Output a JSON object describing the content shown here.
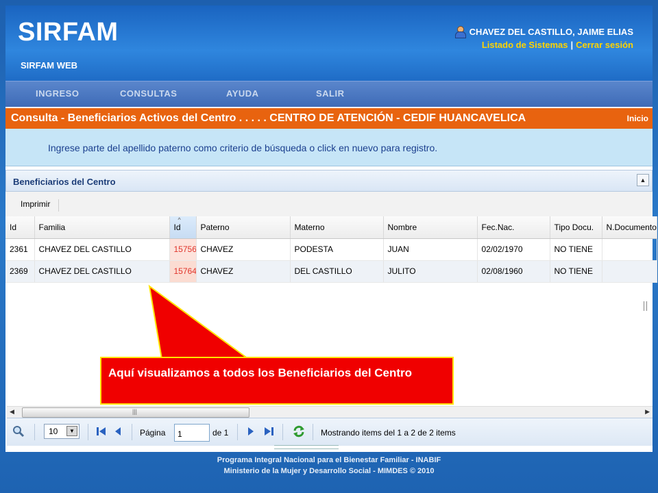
{
  "header": {
    "logo": "SIRFAM",
    "subtitle": "SIRFAM WEB",
    "user_name": "CHAVEZ DEL CASTILLO, JAIME ELIAS",
    "link_systems": "Listado de Sistemas",
    "link_separator": "|",
    "link_logout": "Cerrar sesión"
  },
  "nav": {
    "items": [
      "INGRESO",
      "CONSULTAS",
      "AYUDA",
      "SALIR"
    ]
  },
  "page": {
    "title": "Consulta - Beneficiarios Activos del Centro . . . . . CENTRO DE ATENCIÓN - CEDIF HUANCAVELICA",
    "inicio": "Inicio",
    "instructions": "Ingrese parte del apellido paterno como criterio de búsqueda o click en nuevo para registro."
  },
  "grid": {
    "title": "Beneficiarios del Centro",
    "toolbar_print": "Imprimir",
    "columns": [
      "Id",
      "Familia",
      "Id",
      "Paterno",
      "Materno",
      "Nombre",
      "Fec.Nac.",
      "Tipo Docu.",
      "N.Documento"
    ],
    "rows": [
      [
        "2361",
        "CHAVEZ DEL CASTILLO",
        "15756",
        "CHAVEZ",
        "PODESTA",
        "JUAN",
        "02/02/1970",
        "NO TIENE",
        ""
      ],
      [
        "2369",
        "CHAVEZ DEL CASTILLO",
        "15764",
        "CHAVEZ",
        "DEL CASTILLO",
        "JULITO",
        "02/08/1960",
        "NO TIENE",
        ""
      ]
    ]
  },
  "callout": {
    "text": "Aquí visualizamos a todos los Beneficiarios del Centro"
  },
  "pager": {
    "page_size": "10",
    "page_label": "Página",
    "page_value": "1",
    "of_label": "de 1",
    "status": "Mostrando items del 1 a 2 de 2 items"
  },
  "footer": {
    "line1": "Programa Integral Nacional para el Bienestar Familiar - INABIF",
    "line2": "Ministerio de la Mujer y Desarrollo Social - MIMDES © 2010"
  },
  "colors": {
    "title_bar": "#e8630f",
    "callout": "#f00000",
    "callout_border": "#ffe400",
    "link": "#ffd400"
  }
}
